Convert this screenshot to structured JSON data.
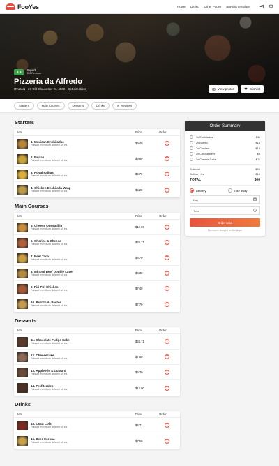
{
  "header": {
    "brand": "FooYes",
    "nav": [
      "Home",
      "Listing",
      "Other Pages",
      "Buy this template"
    ]
  },
  "hero": {
    "rating_score": "8.9",
    "rating_label": "Superb",
    "rating_count": "350 Reviews",
    "title": "Pizzeria da Alfredo",
    "address": "ITALIAN - 27 Old Gloucester St, 4530 - ",
    "directions": "Get directions",
    "view_photos": "View photos",
    "wishlist": "Wishlist"
  },
  "tabs": [
    "Starters",
    "Main Courses",
    "Desserts",
    "Drinks",
    "Reviews"
  ],
  "table_headers": {
    "item": "Item",
    "price": "Price",
    "order": "Order"
  },
  "sections": [
    {
      "title": "Starters",
      "items": [
        {
          "name": "1. Mexican Enchiladas",
          "desc": "Fuisset mentitum deleniti sit ea.",
          "price": "$9.40",
          "color": "#b7863a"
        },
        {
          "name": "2. Fajitas",
          "desc": "Fuisset mentitum deleniti sit ea.",
          "price": "$6.80",
          "color": "#c9a23c"
        },
        {
          "name": "3. Royal Fajitas",
          "desc": "Fuisset mentitum deleniti sit ea.",
          "price": "$5.70",
          "color": "#d8b03a"
        },
        {
          "name": "4. Chicken Enchilada Wrap",
          "desc": "Fuisset mentitum deleniti sit ea.",
          "price": "$5.20",
          "color": "#b79a4a"
        }
      ]
    },
    {
      "title": "Main Courses",
      "items": [
        {
          "name": "5. Cheese Quesadilla",
          "desc": "Fuisset mentitum deleniti sit ea.",
          "price": "$12.00",
          "color": "#c58d3e"
        },
        {
          "name": "6. Chorizo & Cheese",
          "desc": "Fuisset mentitum deleniti sit ea.",
          "price": "$24.71",
          "color": "#b0603a"
        },
        {
          "name": "7. Beef Taco",
          "desc": "Fuisset mentitum deleniti sit ea.",
          "price": "$8.70",
          "color": "#c8a044"
        },
        {
          "name": "8. Minced Beef Double Layer",
          "desc": "Fuisset mentitum deleniti sit ea.",
          "price": "$6.30",
          "color": "#b08a42"
        },
        {
          "name": "9. Piri Piri Chicken",
          "desc": "Fuisset mentitum deleniti sit ea.",
          "price": "$7.40",
          "color": "#a55a35"
        },
        {
          "name": "10. Burrito Al Pastor",
          "desc": "Fuisset mentitum deleniti sit ea.",
          "price": "$7.70",
          "color": "#c49a4c"
        }
      ]
    },
    {
      "title": "Desserts",
      "items": [
        {
          "name": "11. Chocolate Fudge Cake",
          "desc": "Fuisset mentitum deleniti sit ea.",
          "price": "$24.71",
          "color": "#5a3a2a"
        },
        {
          "name": "12. Cheesecake",
          "desc": "Fuisset mentitum deleniti sit ea.",
          "price": "$7.50",
          "color": "#8c6a5a"
        },
        {
          "name": "13. Apple Pie & Custard",
          "desc": "Fuisset mentitum deleniti sit ea.",
          "price": "$5.70",
          "color": "#6a4a3a"
        },
        {
          "name": "14. Profiteroles",
          "desc": "Fuisset mentitum deleniti sit ea.",
          "price": "$12.00",
          "color": "#4a3026"
        }
      ]
    },
    {
      "title": "Drinks",
      "items": [
        {
          "name": "15. Coca Cola",
          "desc": "Fuisset mentitum deleniti sit ea.",
          "price": "$4.71",
          "color": "#7a2a20"
        },
        {
          "name": "16. Beer Corona",
          "desc": "Fuisset mentitum deleniti sit ea.",
          "price": "$7.50",
          "color": "#c7a048"
        }
      ]
    }
  ],
  "order": {
    "title": "Order Summary",
    "lines": [
      {
        "label": "1x Enchiladas",
        "price": "$11"
      },
      {
        "label": "2x Burrito",
        "price": "$14"
      },
      {
        "label": "1x Chicken",
        "price": "$18"
      },
      {
        "label": "2x Corona Beer",
        "price": "$9"
      },
      {
        "label": "2x Cheese Cake",
        "price": "$11"
      }
    ],
    "subtotal_label": "Subtotal",
    "subtotal": "$56",
    "fee_label": "Delivery fee",
    "fee": "$10",
    "total_label": "TOTAL",
    "total": "$66",
    "delivery": "Delivery",
    "take_away": "Take away",
    "day_placeholder": "Day",
    "time_placeholder": "Time",
    "button": "Order Now",
    "note": "No money charged on this steps"
  },
  "colors": {
    "accent": "#e54d42",
    "rating": "#3aa14a",
    "dark": "#333333"
  }
}
